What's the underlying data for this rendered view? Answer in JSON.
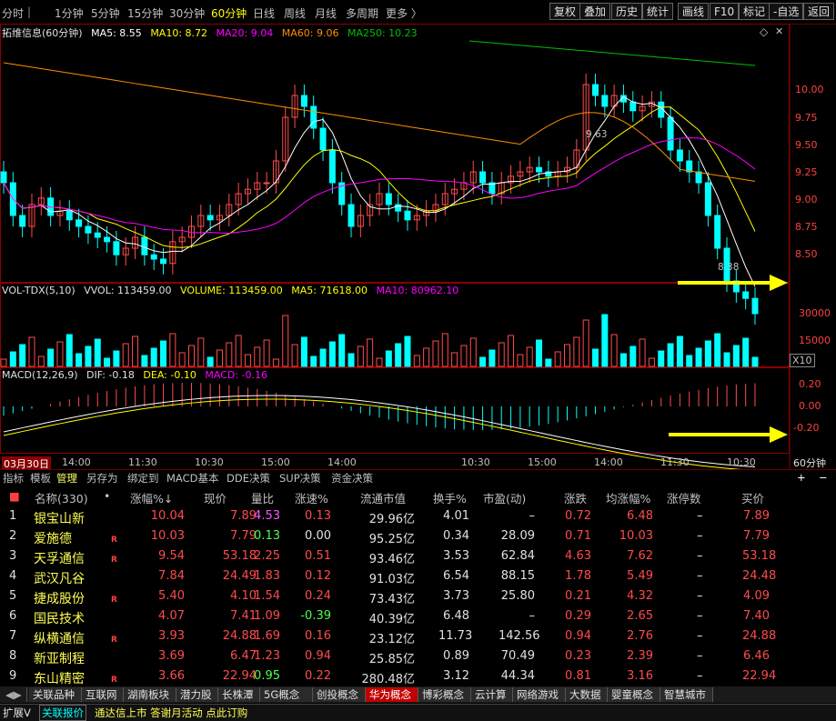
{
  "toolbar": {
    "periods": [
      "分时",
      "1分钟",
      "5分钟",
      "15分钟",
      "30分钟",
      "60分钟",
      "日线",
      "周线",
      "月线",
      "多周期",
      "更多 〉"
    ],
    "active_period": "60分钟",
    "right_buttons": [
      "复权",
      "叠加",
      "历史",
      "统计",
      "画线",
      "F10",
      "标记",
      "-自选",
      "返回"
    ]
  },
  "main_chart": {
    "title": "拓维信息(60分钟)",
    "ma5": "MA5: 8.55",
    "ma10": "MA10: 8.72",
    "ma20": "MA20: 9.04",
    "ma60": "MA60: 9.06",
    "ma250": "MA250: 10.23",
    "price_ticks": [
      "10.00",
      "9.75",
      "9.50",
      "9.25",
      "9.00",
      "8.75",
      "8.50"
    ],
    "high_label": "9.63",
    "low_label": "8.38"
  },
  "vol_chart": {
    "title": "VOL-TDX(5,10)",
    "vvol": "VVOL: 113459.00",
    "volume": "VOLUME: 113459.00",
    "ma5": "MA5: 71618.00",
    "ma10": "MA10: 80962.10",
    "ticks": [
      "30000",
      "15000"
    ],
    "unit": "X10"
  },
  "macd_chart": {
    "title": "MACD(12,26,9)",
    "dif": "DIF: -0.18",
    "dea": "DEA: -0.10",
    "macd": "MACD: -0.16",
    "ticks": [
      "0.20",
      "0.00",
      "-0.20"
    ]
  },
  "x_axis": {
    "labels": [
      "03月30日",
      "14:00",
      "11:30",
      "10:30",
      "15:00",
      "14:00",
      "10:30",
      "15:00",
      "14:00",
      "11:30",
      "10:30"
    ],
    "period_label": "60分钟"
  },
  "tool_tabs": [
    "指标",
    "模板",
    "管理",
    "另存为",
    "绑定到",
    "MACD基本",
    "DDE决策",
    "SUP决策",
    "资金决策"
  ],
  "active_tool_tab": "管理",
  "table": {
    "headers": [
      "名称(330)",
      "•",
      "涨幅%↓",
      "现价",
      "量比",
      "涨速%",
      "流通市值",
      "换手%",
      "市盈(动)",
      "涨跌",
      "均涨幅%",
      "涨停数",
      "买价"
    ],
    "rows": [
      {
        "idx": "1",
        "name": "银宝山新",
        "r": "",
        "chg": "10.04",
        "price": "7.89",
        "lb": "4.53",
        "speed": "0.13",
        "mcap": "29.96亿",
        "turn": "4.01",
        "pe": "–",
        "diff": "0.72",
        "avg": "6.48",
        "limit": "–",
        "bid": "7.89"
      },
      {
        "idx": "2",
        "name": "爱施德",
        "r": "R",
        "chg": "10.03",
        "price": "7.79",
        "lb": "0.13",
        "speed": "0.00",
        "mcap": "95.25亿",
        "turn": "0.34",
        "pe": "28.09",
        "diff": "0.71",
        "avg": "10.03",
        "limit": "–",
        "bid": "7.79"
      },
      {
        "idx": "3",
        "name": "天孚通信",
        "r": "R",
        "chg": "9.54",
        "price": "53.18",
        "lb": "2.25",
        "speed": "0.51",
        "mcap": "93.46亿",
        "turn": "3.53",
        "pe": "62.84",
        "diff": "4.63",
        "avg": "7.62",
        "limit": "–",
        "bid": "53.18"
      },
      {
        "idx": "4",
        "name": "武汉凡谷",
        "r": "",
        "chg": "7.84",
        "price": "24.49",
        "lb": "1.83",
        "speed": "0.12",
        "mcap": "91.03亿",
        "turn": "6.54",
        "pe": "88.15",
        "diff": "1.78",
        "avg": "5.49",
        "limit": "–",
        "bid": "24.48"
      },
      {
        "idx": "5",
        "name": "捷成股份",
        "r": "R",
        "chg": "5.40",
        "price": "4.10",
        "lb": "1.54",
        "speed": "0.24",
        "mcap": "73.43亿",
        "turn": "3.73",
        "pe": "25.80",
        "diff": "0.21",
        "avg": "4.32",
        "limit": "–",
        "bid": "4.09"
      },
      {
        "idx": "6",
        "name": "国民技术",
        "r": "",
        "chg": "4.07",
        "price": "7.41",
        "lb": "1.09",
        "speed": "-0.39",
        "mcap": "40.39亿",
        "turn": "6.48",
        "pe": "–",
        "diff": "0.29",
        "avg": "2.65",
        "limit": "–",
        "bid": "7.40"
      },
      {
        "idx": "7",
        "name": "纵横通信",
        "r": "R",
        "chg": "3.93",
        "price": "24.88",
        "lb": "1.69",
        "speed": "0.16",
        "mcap": "23.12亿",
        "turn": "11.73",
        "pe": "142.56",
        "diff": "0.94",
        "avg": "2.76",
        "limit": "–",
        "bid": "24.88"
      },
      {
        "idx": "8",
        "name": "新亚制程",
        "r": "",
        "chg": "3.69",
        "price": "6.47",
        "lb": "1.23",
        "speed": "0.94",
        "mcap": "25.85亿",
        "turn": "0.89",
        "pe": "70.49",
        "diff": "0.23",
        "avg": "2.39",
        "limit": "–",
        "bid": "6.46"
      },
      {
        "idx": "9",
        "name": "东山精密",
        "r": "R",
        "chg": "3.66",
        "price": "22.94",
        "lb": "0.95",
        "speed": "0.22",
        "mcap": "280.48亿",
        "turn": "3.12",
        "pe": "44.34",
        "diff": "0.81",
        "avg": "3.16",
        "limit": "–",
        "bid": "22.94"
      }
    ]
  },
  "bottom_tabs": [
    "关联品种",
    "互联网",
    "湖南板块",
    "潜力股",
    "长株潭",
    "5G概念",
    "创投概念",
    "华为概念",
    "博彩概念",
    "云计算",
    "网络游戏",
    "大数据",
    "婴童概念",
    "智慧城市"
  ],
  "active_bottom_tab": "华为概念",
  "status": {
    "expand": "扩展V",
    "related": "关联报价",
    "news": "通达信上市 答谢月活动 点此订购"
  },
  "colors": {
    "up": "#ff4b4b",
    "down": "#00ffff",
    "ma5": "#ffffff",
    "ma10": "#ffff00",
    "ma20": "#ff00ff",
    "ma60": "#ff8c00",
    "ma250": "#00c000",
    "arrow": "#ffff00"
  }
}
